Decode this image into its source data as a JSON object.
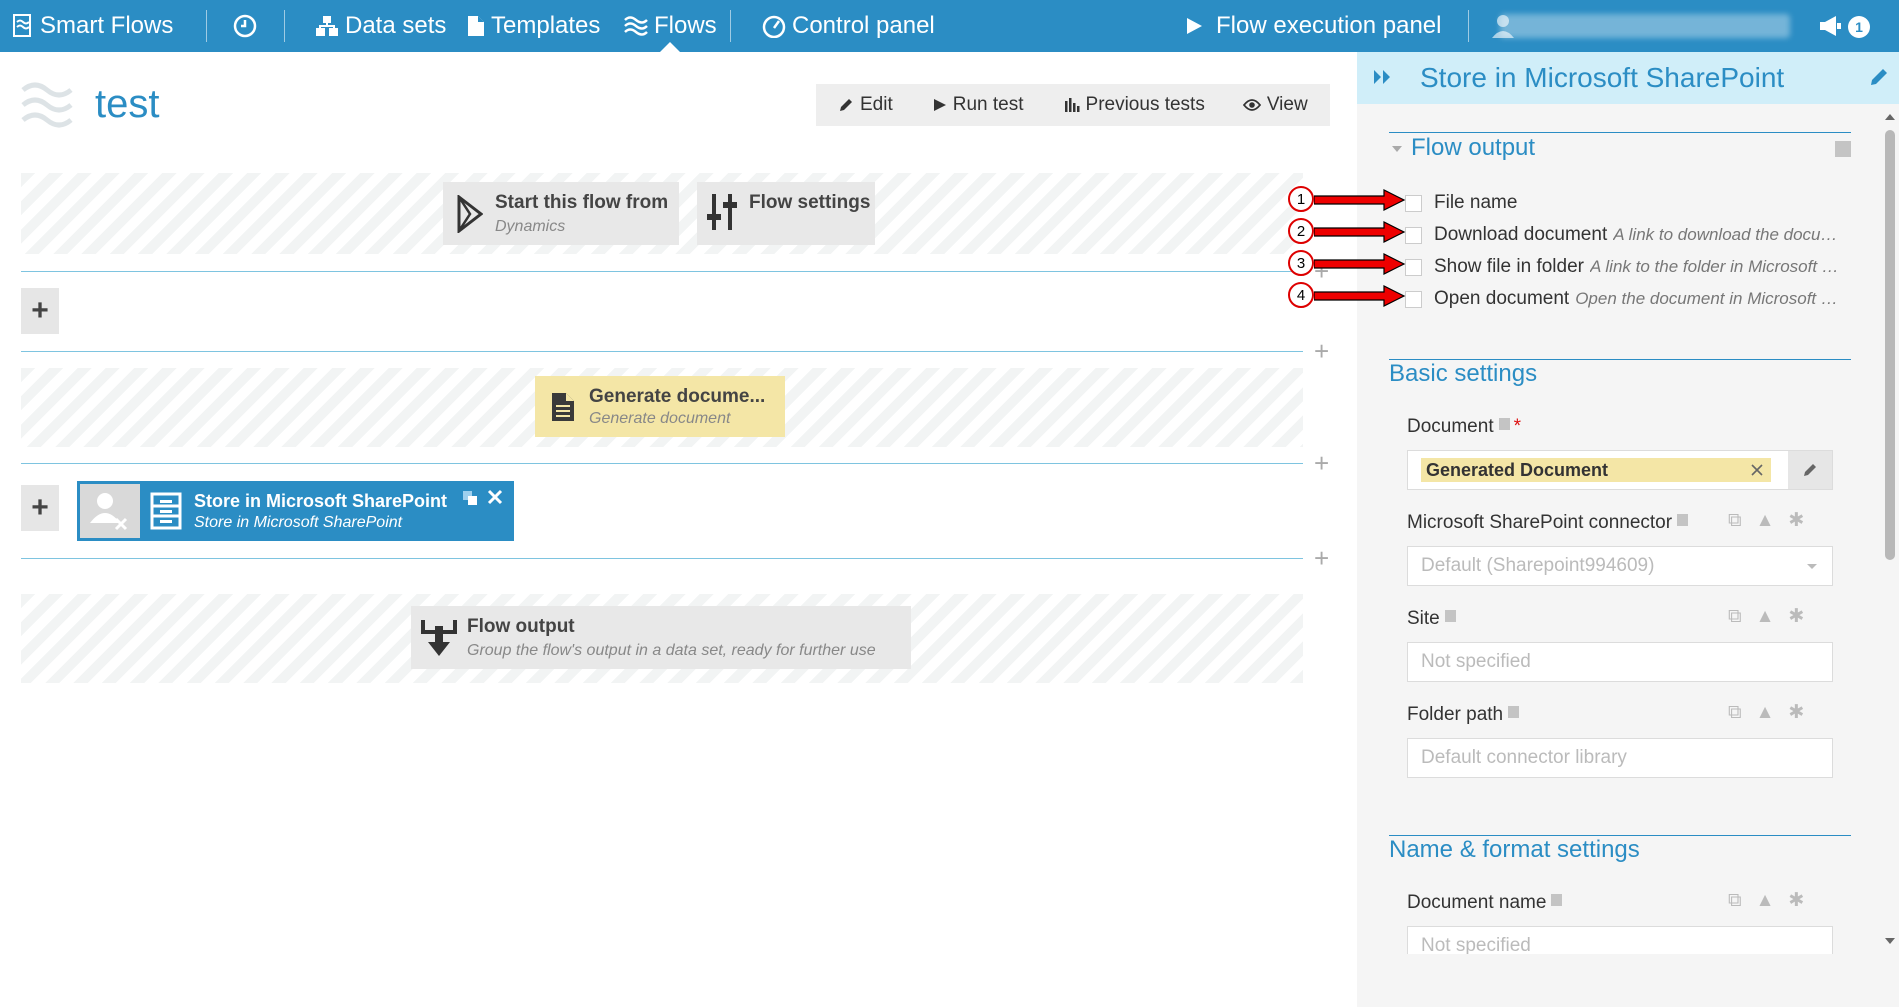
{
  "nav": {
    "brand": "Smart Flows",
    "items": [
      "Data sets",
      "Templates",
      "Flows",
      "Control panel"
    ],
    "execution_panel": "Flow execution panel",
    "notification_count": "1"
  },
  "page": {
    "title": "test",
    "toolbar": {
      "edit": "Edit",
      "run_test": "Run test",
      "previous_tests": "Previous tests",
      "view": "View"
    }
  },
  "flow": {
    "start": {
      "title": "Start this flow from",
      "subtitle": "Dynamics"
    },
    "settings": {
      "title": "Flow settings"
    },
    "generate": {
      "title": "Generate docume...",
      "subtitle": "Generate document"
    },
    "store": {
      "title": "Store in Microsoft SharePoint",
      "subtitle": "Store in Microsoft SharePoint"
    },
    "output": {
      "title": "Flow output",
      "subtitle": "Group the flow's output in a data set, ready for further use"
    }
  },
  "panel": {
    "title": "Store in Microsoft SharePoint",
    "flow_output": {
      "title": "Flow output",
      "items": [
        {
          "label": "File name",
          "desc": ""
        },
        {
          "label": "Download document",
          "desc": "A link to download the document"
        },
        {
          "label": "Show file in folder",
          "desc": "A link to the folder in Microsoft SharePoint"
        },
        {
          "label": "Open document",
          "desc": "Open the document in Microsoft SharePoint"
        }
      ]
    },
    "basic_settings": {
      "title": "Basic settings",
      "document_label": "Document",
      "document_value": "Generated Document",
      "connector_label": "Microsoft SharePoint connector",
      "connector_value": "Default (Sharepoint994609)",
      "site_label": "Site",
      "site_placeholder": "Not specified",
      "folder_label": "Folder path",
      "folder_placeholder": "Default connector library"
    },
    "name_format": {
      "title": "Name & format settings",
      "docname_label": "Document name",
      "docname_placeholder": "Not specified"
    }
  },
  "annotations": [
    "1",
    "2",
    "3",
    "4"
  ],
  "colors": {
    "brand": "#2b8dc4",
    "panel_header": "#d0eef9",
    "generate_step": "#f4e6a6",
    "store_step": "#2b8dc4",
    "annotation": "#dd0000"
  }
}
